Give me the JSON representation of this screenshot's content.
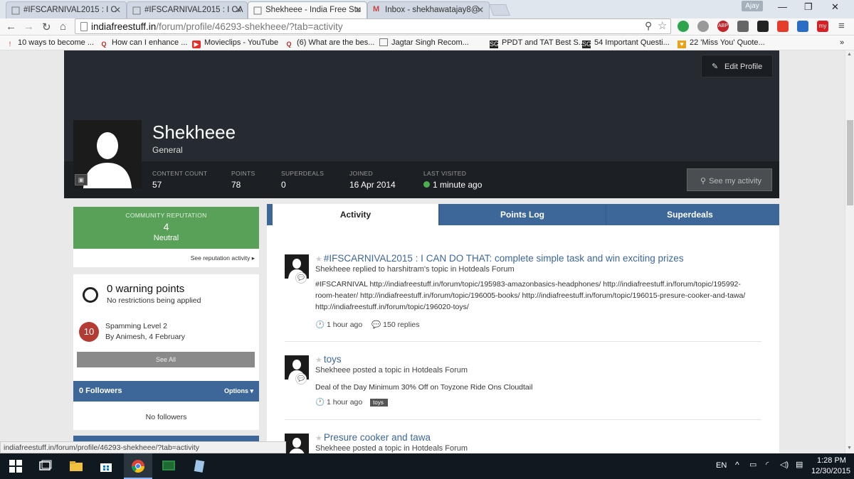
{
  "browser": {
    "tabs": [
      {
        "label": "#IFSCARNIVAL2015 : I C"
      },
      {
        "label": "#IFSCARNIVAL2015 : I CA"
      },
      {
        "label": "Shekheee - India Free Stu"
      },
      {
        "label": "Inbox - shekhawatajay8@"
      }
    ],
    "user_chip": "Ajay",
    "url_host": "indiafreestuff.in",
    "url_path": "/forum/profile/46293-shekheee/?tab=activity",
    "bookmarks": [
      "10 ways to become ...",
      "How can I enhance ...",
      "Movieclips - YouTube",
      "(6) What are the bes...",
      "Jagtar Singh Recom...",
      "PPDT and TAT Best S...",
      "54 Important Questi...",
      "22 'Miss You' Quote..."
    ],
    "overflow": "»"
  },
  "profile": {
    "edit_label": "Edit Profile",
    "name": "Shekheee",
    "group": "General",
    "stats": [
      {
        "label": "CONTENT COUNT",
        "value": "57"
      },
      {
        "label": "POINTS",
        "value": "78"
      },
      {
        "label": "SUPERDEALS",
        "value": "0"
      },
      {
        "label": "JOINED",
        "value": "16 Apr 2014"
      },
      {
        "label": "LAST VISITED",
        "value": "1 minute ago"
      }
    ],
    "see_activity": "See my activity"
  },
  "sidebar": {
    "rep_title": "COMMUNITY REPUTATION",
    "rep_value": "4",
    "rep_status": "Neutral",
    "rep_link": "See reputation activity",
    "warn_title": "0 warning points",
    "warn_sub": "No restrictions being applied",
    "warn_badge": "10",
    "warn_item_title": "Spamming Level 2",
    "warn_item_by": "By Animesh, 4 February",
    "see_all": "See All",
    "followers_title": "0 Followers",
    "followers_options": "Options",
    "no_followers": "No followers"
  },
  "profile_tabs": [
    "Activity",
    "Points Log",
    "Superdeals"
  ],
  "feed": [
    {
      "title": "#IFSCARNIVAL2015 : I CAN DO THAT: complete simple task and win exciting prizes",
      "sub": "Shekheee replied to harshitram's topic in Hotdeals Forum",
      "body_lines": [
        "#IFSCARNIVAL http://indiafreestuff.in/forum/topic/195983-amazonbasics-headphones/ http://indiafreestuff.in/forum/topic/195992-",
        "room-heater/ http://indiafreestuff.in/forum/topic/196005-books/ http://indiafreestuff.in/forum/topic/196015-presure-cooker-and-tawa/",
        "http://indiafreestuff.in/forum/topic/196020-toys/"
      ],
      "time": "1 hour ago",
      "replies": "150 replies"
    },
    {
      "title": "toys",
      "sub": "Shekheee posted a topic in Hotdeals Forum",
      "body_lines": [
        "Deal of the Day Minimum 30% Off on Toyzone Ride Ons Cloudtail"
      ],
      "time": "1 hour ago",
      "tag": "toys"
    },
    {
      "title": "Presure cooker and tawa",
      "sub": "Shekheee posted a topic in Hotdeals Forum"
    }
  ],
  "status_url": "indiafreestuff.in/forum/profile/46293-shekheee/?tab=activity",
  "taskbar": {
    "lang": "EN",
    "time": "1:28 PM",
    "date": "12/30/2015"
  }
}
